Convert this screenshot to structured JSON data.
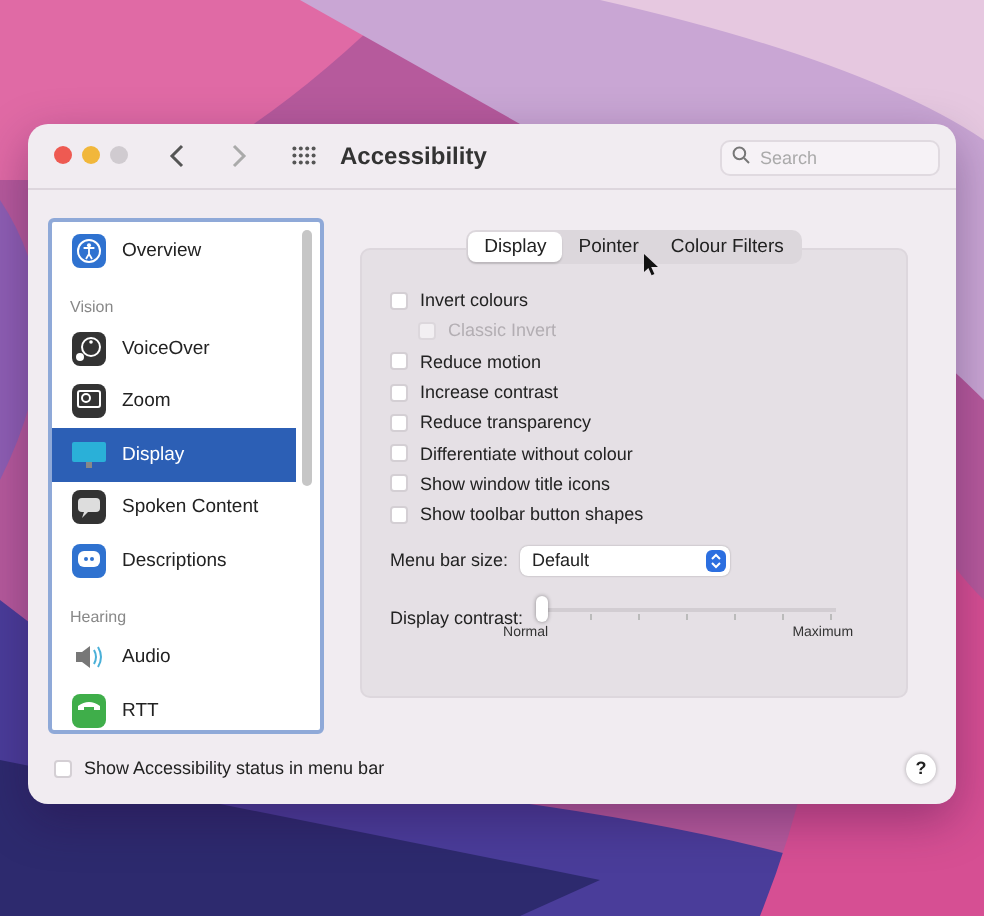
{
  "window": {
    "title": "Accessibility"
  },
  "search": {
    "placeholder": "Search"
  },
  "sidebar": {
    "items": [
      {
        "kind": "item",
        "label": "Overview",
        "selected": false
      },
      {
        "kind": "heading",
        "label": "Vision"
      },
      {
        "kind": "item",
        "label": "VoiceOver",
        "selected": false
      },
      {
        "kind": "item",
        "label": "Zoom",
        "selected": false
      },
      {
        "kind": "item",
        "label": "Display",
        "selected": true
      },
      {
        "kind": "item",
        "label": "Spoken Content",
        "selected": false
      },
      {
        "kind": "item",
        "label": "Descriptions",
        "selected": false
      },
      {
        "kind": "heading",
        "label": "Hearing"
      },
      {
        "kind": "item",
        "label": "Audio",
        "selected": false
      },
      {
        "kind": "item",
        "label": "RTT",
        "selected": false
      }
    ]
  },
  "tabs": [
    {
      "label": "Display",
      "selected": true
    },
    {
      "label": "Pointer",
      "selected": false
    },
    {
      "label": "Colour Filters",
      "selected": false
    }
  ],
  "options": [
    {
      "label": "Invert colours",
      "checked": false,
      "disabled": false,
      "children": [
        {
          "label": "Classic Invert",
          "checked": false,
          "disabled": true
        }
      ]
    },
    {
      "label": "Reduce motion",
      "checked": false,
      "disabled": false
    },
    {
      "label": "Increase contrast",
      "checked": false,
      "disabled": false
    },
    {
      "label": "Reduce transparency",
      "checked": false,
      "disabled": false
    },
    {
      "label": "Differentiate without colour",
      "checked": false,
      "disabled": false
    },
    {
      "label": "Show window title icons",
      "checked": false,
      "disabled": false
    },
    {
      "label": "Show toolbar button shapes",
      "checked": false,
      "disabled": false
    }
  ],
  "menu_bar_size": {
    "label": "Menu bar size:",
    "value": "Default"
  },
  "display_contrast": {
    "label": "Display contrast:",
    "level": 0,
    "min_label": "Normal",
    "max_label": "Maximum"
  },
  "status_option": {
    "label": "Show Accessibility status in menu bar",
    "checked": false
  },
  "help": {
    "label": "?"
  }
}
